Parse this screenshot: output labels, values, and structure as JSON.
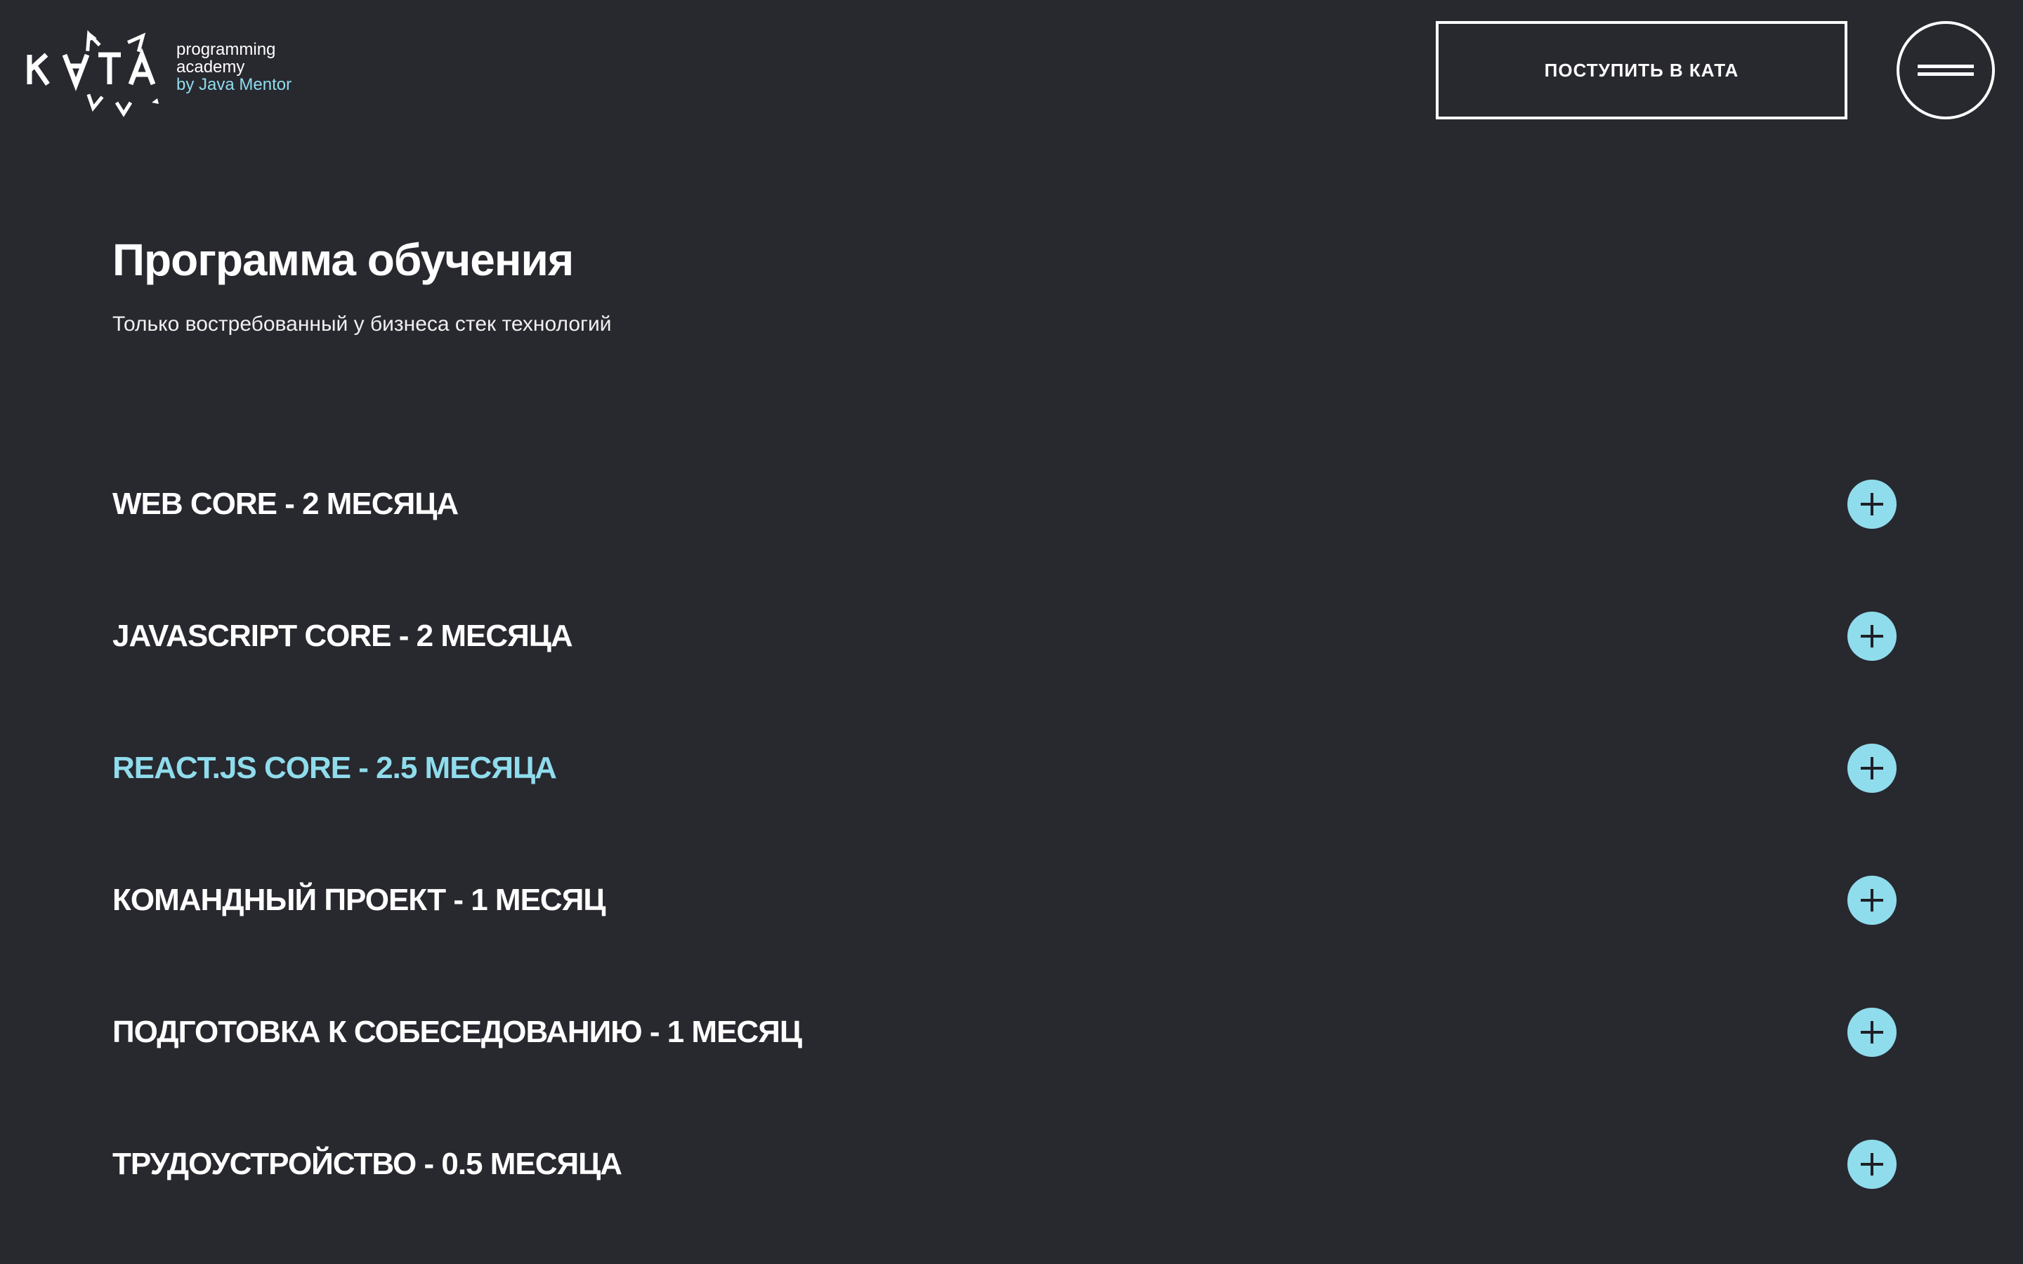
{
  "header": {
    "logo": {
      "brand_letters": "KATA",
      "line1": "programming",
      "line2": "academy",
      "line3": "by Java Mentor"
    },
    "cta_label": "ПОСТУПИТЬ В КАТА",
    "menu_icon": "hamburger-menu-icon"
  },
  "program": {
    "title": "Программа обучения",
    "subtitle": "Только востребованный у бизнеса стек технологий",
    "items": [
      {
        "label": "WEB CORE - 2 МЕСЯЦА",
        "active": false,
        "icon": "plus-icon"
      },
      {
        "label": "JAVASCRIPT CORE - 2 МЕСЯЦА",
        "active": false,
        "icon": "plus-icon"
      },
      {
        "label": "REACT.JS CORE - 2.5 МЕСЯЦА",
        "active": true,
        "icon": "plus-icon"
      },
      {
        "label": "КОМАНДНЫЙ ПРОЕКТ - 1 МЕСЯЦ",
        "active": false,
        "icon": "plus-icon"
      },
      {
        "label": "ПОДГОТОВКА К СОБЕСЕДОВАНИЮ - 1 МЕСЯЦ",
        "active": false,
        "icon": "plus-icon"
      },
      {
        "label": "ТРУДОУСТРОЙСТВО - 0.5 МЕСЯЦА",
        "active": false,
        "icon": "plus-icon"
      }
    ]
  },
  "colors": {
    "background": "#28282f",
    "accent": "#8fdcec",
    "text": "#ffffff"
  }
}
